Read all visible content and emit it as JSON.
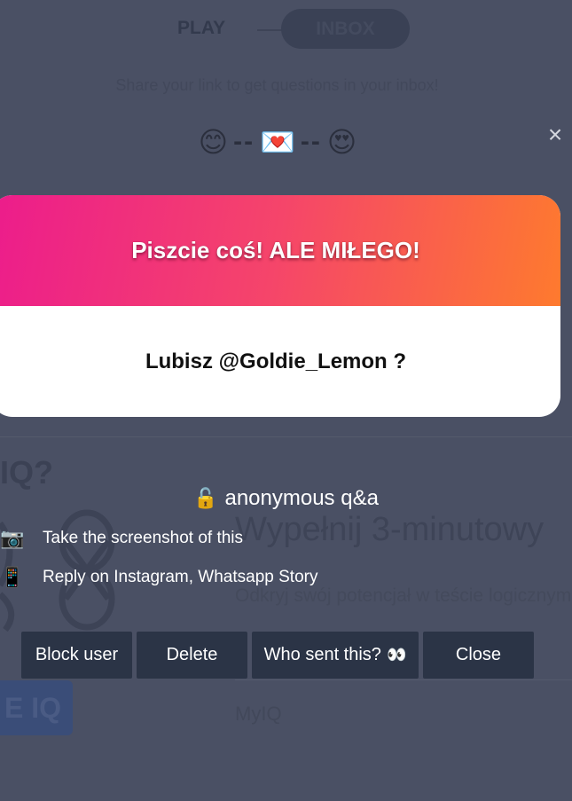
{
  "background": {
    "tabs": [
      "PLAY",
      "INBOX"
    ],
    "share_text": "Share your link to get questions in your inbox!",
    "iq_heading": "IQ?",
    "promo_title": "Wypełnij 3-minutowy",
    "promo_subtitle": "Odkryj swój potencjał w teście logicznym",
    "cta_label": "E IQ",
    "brand": "MyIQ"
  },
  "modal": {
    "emoji_left": "😊",
    "emoji_mid": "💌",
    "emoji_right": "😍",
    "dashes": "--",
    "close_symbol": "×",
    "card": {
      "header_text": "Piszcie coś! ALE MIŁEGO!",
      "question": "Lubisz @Goldie_Lemon ?"
    },
    "anon_icon": "🔓",
    "anon_label": "anonymous q&a",
    "tips": [
      {
        "icon": "📷",
        "text": "Take the screenshot of this"
      },
      {
        "icon": "📱",
        "text": "Reply on Instagram, Whatsapp Story"
      }
    ],
    "buttons": {
      "block": "Block user",
      "delete": "Delete",
      "who": "Who sent this?",
      "who_emoji": "👀",
      "close": "Close"
    }
  }
}
